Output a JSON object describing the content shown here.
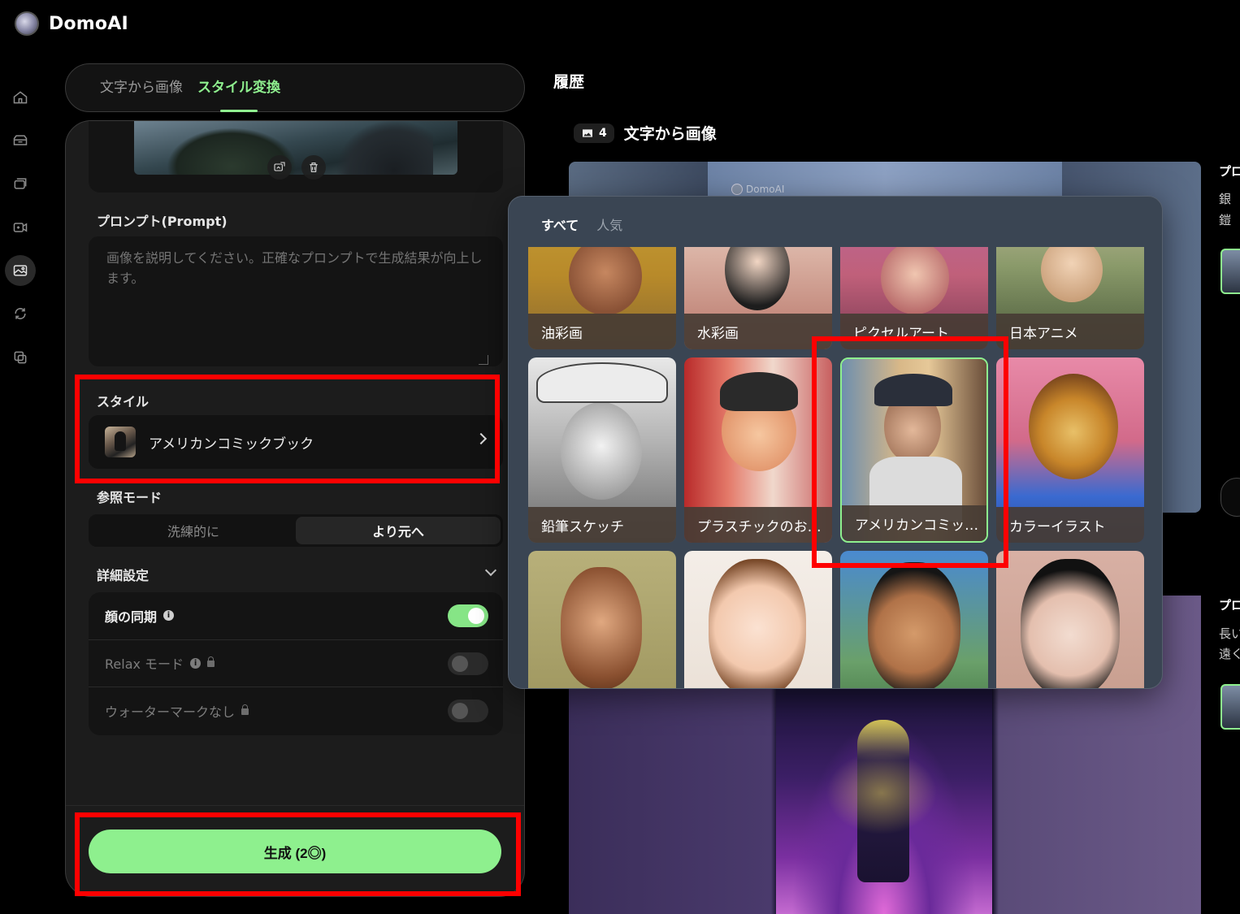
{
  "app": {
    "name": "DomoAI"
  },
  "nav": {
    "items": [
      {
        "icon": "home-icon"
      },
      {
        "icon": "box-icon"
      },
      {
        "icon": "stack-icon"
      },
      {
        "icon": "video-icon"
      },
      {
        "icon": "image-icon",
        "active": true
      },
      {
        "icon": "refresh-icon"
      },
      {
        "icon": "copy-icon"
      }
    ]
  },
  "mode_tabs": [
    {
      "label": "文字から画像",
      "active": false
    },
    {
      "label": "スタイル変換",
      "active": true
    }
  ],
  "prompt": {
    "label": "プロンプト(Prompt)",
    "placeholder": "画像を説明してください。正確なプロンプトで生成結果が向上します。"
  },
  "style": {
    "label": "スタイル",
    "selected": "アメリカンコミックブック"
  },
  "reference_mode": {
    "label": "参照モード",
    "options": [
      "洗練的に",
      "より元へ"
    ],
    "selected": "より元へ"
  },
  "advanced": {
    "label": "詳細設定",
    "settings": [
      {
        "label": "顔の同期",
        "on": true,
        "locked": false
      },
      {
        "label": "Relax モード",
        "on": false,
        "locked": true
      },
      {
        "label": "ウォーターマークなし",
        "on": false,
        "locked": true
      }
    ]
  },
  "generate": {
    "label": "生成 (2◎)"
  },
  "history": {
    "title": "履歴",
    "group_title": "文字から画像",
    "count": "4",
    "watermark": "DomoAI",
    "side_texts": [
      "プロ",
      "銀",
      "鎧",
      "プロ",
      "長い",
      "遠く"
    ]
  },
  "style_picker": {
    "tabs": [
      {
        "label": "すべて",
        "active": true
      },
      {
        "label": "人気",
        "active": false
      }
    ],
    "styles": [
      {
        "label": "油彩画"
      },
      {
        "label": "水彩画"
      },
      {
        "label": "ピクセルアート"
      },
      {
        "label": "日本アニメ"
      },
      {
        "label": "鉛筆スケッチ"
      },
      {
        "label": "プラスチックのお…"
      },
      {
        "label": "アメリカンコミッ…",
        "selected": true
      },
      {
        "label": "カラーイラスト"
      },
      {
        "label": ""
      },
      {
        "label": ""
      },
      {
        "label": ""
      },
      {
        "label": ""
      }
    ]
  },
  "colors": {
    "accent": "#8ef08e",
    "highlight": "#ff0000"
  }
}
